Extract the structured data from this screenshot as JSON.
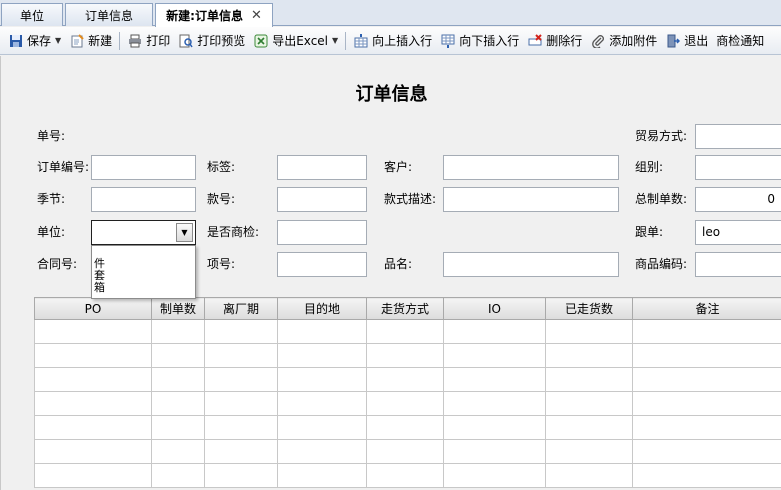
{
  "tabs": [
    {
      "label": "单位"
    },
    {
      "label": "订单信息"
    },
    {
      "label": "新建:订单信息",
      "close": "✕"
    }
  ],
  "toolbar": {
    "save": "保存",
    "new": "新建",
    "print": "打印",
    "print_preview": "打印预览",
    "export_excel": "导出Excel",
    "insert_above": "向上插入行",
    "insert_below": "向下插入行",
    "delete_row": "删除行",
    "add_attachment": "添加附件",
    "exit": "退出",
    "inspection_notice": "商检通知"
  },
  "form": {
    "title": "订单信息",
    "order_no_label": "单号:",
    "trade_method_label": "贸易方式:",
    "order_code_label": "订单编号:",
    "tag_label": "标签:",
    "customer_label": "客户:",
    "group_label": "组别:",
    "season_label": "季节:",
    "style_no_label": "款号:",
    "style_desc_label": "款式描述:",
    "total_qty_label": "总制单数:",
    "total_qty_value": "0",
    "unit_label": "单位:",
    "unit_value": "",
    "inspection_label": "是否商检:",
    "follower_label": "跟单:",
    "follower_value": "leo",
    "contract_label": "合同号:",
    "item_label": "项号:",
    "product_name_label": "品名:",
    "product_code_label": "商品编码:"
  },
  "unit_options": [
    "件",
    "套",
    "箱"
  ],
  "grid": {
    "columns": [
      "PO",
      "制单数",
      "离厂期",
      "目的地",
      "走货方式",
      "IO",
      "已走货数",
      "备注"
    ],
    "rows": 7
  }
}
